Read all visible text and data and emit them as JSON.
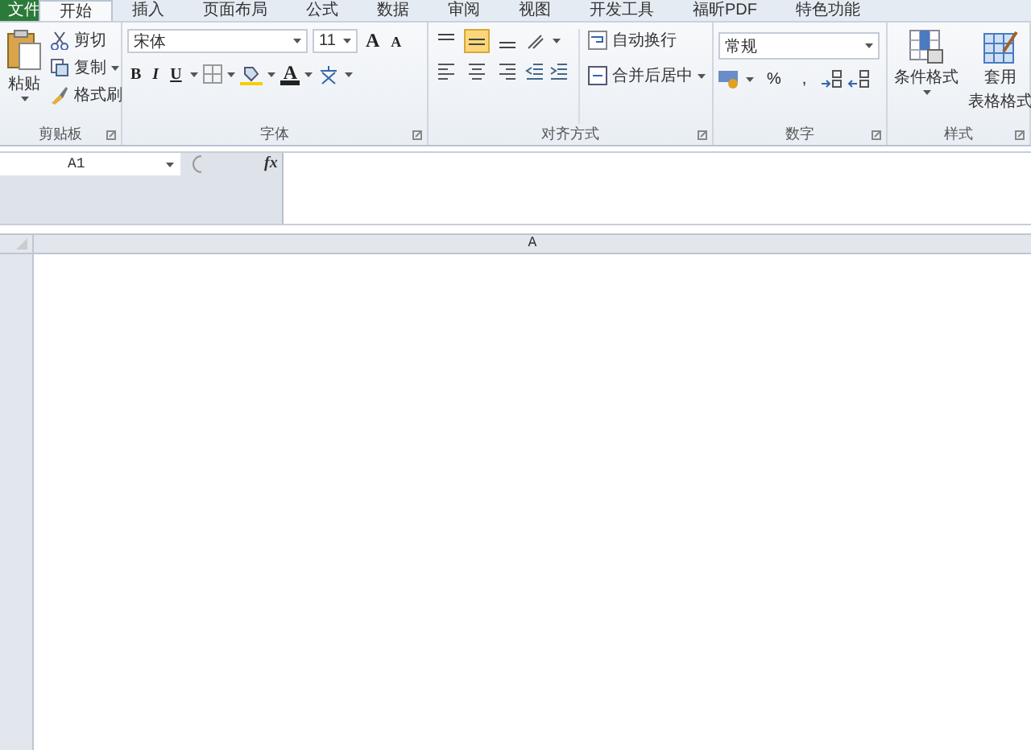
{
  "tabs": [
    {
      "label": "文件",
      "kind": "file",
      "selected": false
    },
    {
      "label": "开始",
      "kind": "tab",
      "selected": true
    },
    {
      "label": "插入",
      "kind": "tab",
      "selected": false
    },
    {
      "label": "页面布局",
      "kind": "tab",
      "selected": false
    },
    {
      "label": "公式",
      "kind": "tab",
      "selected": false
    },
    {
      "label": "数据",
      "kind": "tab",
      "selected": false
    },
    {
      "label": "审阅",
      "kind": "tab",
      "selected": false
    },
    {
      "label": "视图",
      "kind": "tab",
      "selected": false
    },
    {
      "label": "开发工具",
      "kind": "tab",
      "selected": false
    },
    {
      "label": "福昕PDF",
      "kind": "tab",
      "selected": false
    },
    {
      "label": "特色功能",
      "kind": "tab",
      "selected": false
    }
  ],
  "clipboard": {
    "paste": "粘贴",
    "items": [
      {
        "label": "剪切",
        "kind": "cut",
        "dropdown": false
      },
      {
        "label": "复制",
        "kind": "copy",
        "dropdown": true
      },
      {
        "label": "格式刷",
        "kind": "brush",
        "dropdown": false
      }
    ],
    "group": "剪贴板"
  },
  "font": {
    "font_name": "宋体",
    "font_size": "11",
    "grow": "A",
    "shrink": "A",
    "styles": [
      "B",
      "I",
      "U"
    ],
    "font_color": "A",
    "group": "字体"
  },
  "alignment": {
    "vertical": [
      {
        "kind": "top",
        "selected": false
      },
      {
        "kind": "middle",
        "selected": true
      },
      {
        "kind": "bottom",
        "selected": false
      }
    ],
    "wrap": "自动换行",
    "merge": "合并后居中",
    "group": "对齐方式"
  },
  "number": {
    "format": "常规",
    "percent": "%",
    "comma": ",",
    "group": "数字"
  },
  "styles": {
    "conditional": "条件格式",
    "table_1": "套用",
    "table_2": "表格格式",
    "group": "样式"
  },
  "formula_bar": {
    "name_box": "A1",
    "fx": "fx"
  },
  "sheet": {
    "columns": [
      "A"
    ]
  }
}
